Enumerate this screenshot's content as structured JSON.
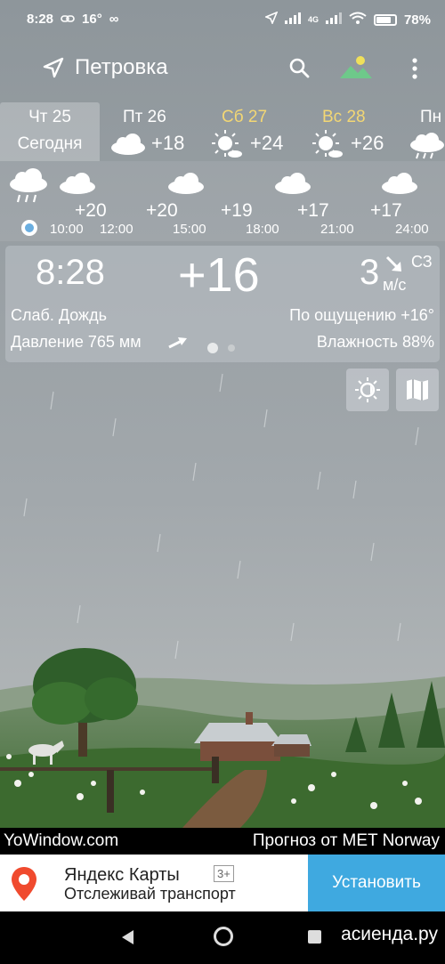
{
  "status_bar": {
    "time": "8:28",
    "temp_indicator": "16°",
    "network": "4G",
    "battery": "78%",
    "battery_level": 0.78,
    "icons": [
      "link-icon",
      "infinity-icon",
      "location-arrow-icon",
      "signal-icon",
      "wifi-icon",
      "battery-icon"
    ]
  },
  "header": {
    "location": "Петровка",
    "icons": [
      "location-arrow-icon",
      "search-icon",
      "landscape-icon",
      "more-vert-icon"
    ]
  },
  "days": [
    {
      "name": "Чт 25",
      "sub": "Сегодня",
      "weekend": false
    },
    {
      "name": "Пт 26",
      "temp": "+18",
      "icon": "cloud-icon",
      "weekend": false
    },
    {
      "name": "Сб 27",
      "temp": "+24",
      "icon": "sun-cloud-icon",
      "weekend": true
    },
    {
      "name": "Вс 28",
      "temp": "+26",
      "icon": "sun-cloud-icon",
      "weekend": true
    },
    {
      "name": "Пн",
      "icon": "rain-cloud-icon",
      "weekend": false
    }
  ],
  "hourly": [
    {
      "temp": "+20",
      "time": "10:00",
      "icon": "rain-cloud-icon"
    },
    {
      "temp": "+20",
      "time": "12:00",
      "icon": "cloud-icon"
    },
    {
      "temp": "+19",
      "time": "15:00",
      "icon": "cloud-icon"
    },
    {
      "temp": "+17",
      "time": "18:00",
      "icon": "cloud-icon"
    },
    {
      "temp": "+17",
      "time": "21:00",
      "icon": "cloud-icon"
    },
    {
      "temp": "",
      "time": "24:00",
      "icon": "cloud-icon"
    }
  ],
  "current": {
    "time": "8:28",
    "temp": "+16",
    "wind_speed": "3",
    "wind_dir": "СЗ",
    "wind_unit": "м/с",
    "condition": "Слаб. Дождь",
    "feels_like": "По ощущению +16°",
    "pressure": "Давление 765 мм",
    "humidity": "Влажность 88%"
  },
  "credits": {
    "left": "YoWindow.com",
    "right": "Прогноз от MET Norway"
  },
  "ad": {
    "title": "Яндекс Карты",
    "age": "3+",
    "subtitle": "Отслеживай транспорт",
    "button": "Установить",
    "accent": "#3fa9e0"
  },
  "watermark": "асиенда.ру"
}
